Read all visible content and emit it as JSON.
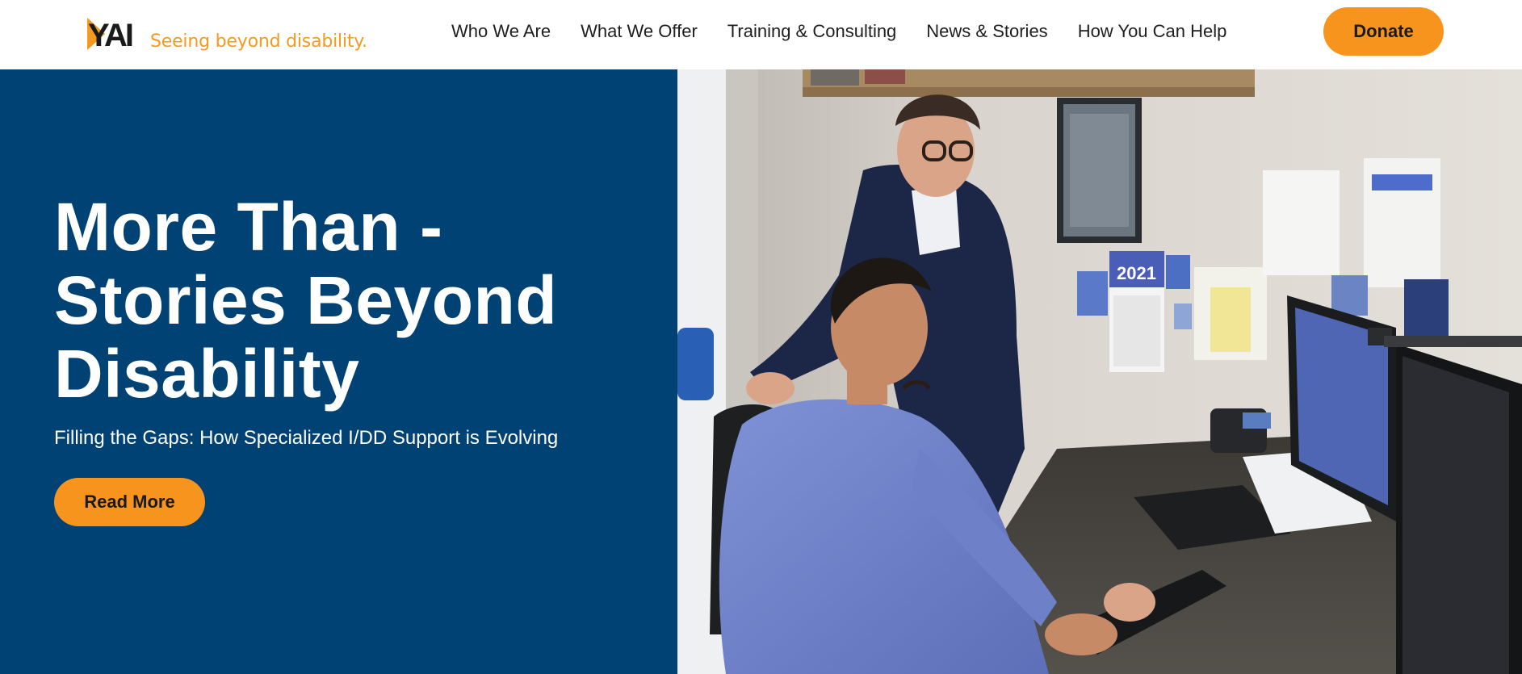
{
  "brand": {
    "name": "YAI",
    "tagline": "Seeing beyond disability.",
    "accent_color": "#f7941d",
    "navy_color": "#004274"
  },
  "nav": {
    "items": [
      {
        "label": "Who We Are"
      },
      {
        "label": "What We Offer"
      },
      {
        "label": "Training & Consulting"
      },
      {
        "label": "News & Stories"
      },
      {
        "label": "How You Can Help"
      }
    ],
    "donate_label": "Donate"
  },
  "hero": {
    "title": "More Than - Stories Beyond Disability",
    "subtitle": "Filling the Gaps: How Specialized I/DD Support is Evolving",
    "cta_label": "Read More",
    "calendar_year": "2021"
  }
}
